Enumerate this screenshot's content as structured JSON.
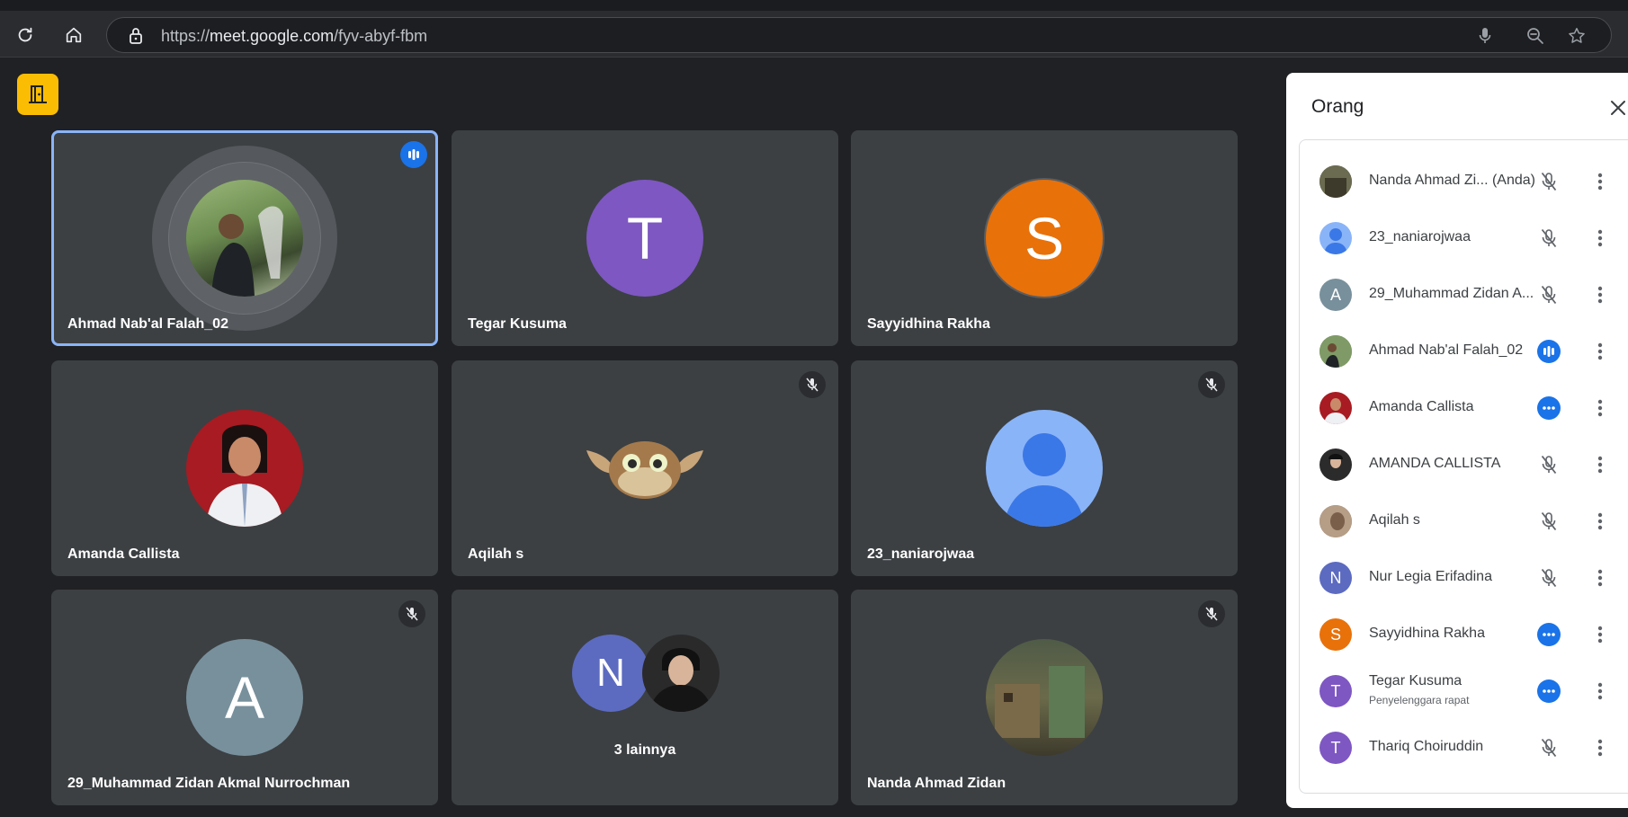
{
  "browser": {
    "url_prefix": "https://",
    "url_host": "meet.google.com",
    "url_path": "/fyv-abyf-fbm",
    "icons": [
      "reload-icon",
      "home-icon",
      "lock-icon",
      "microphone-icon",
      "zoom-icon",
      "star-icon"
    ]
  },
  "meet": {
    "accent_color": "#8ab4f8",
    "tiles": [
      {
        "name": "Ahmad Nab'al Falah_02",
        "status": "speaking"
      },
      {
        "name": "Tegar Kusuma",
        "initial": "T",
        "color": "#7e57c2"
      },
      {
        "name": "Sayyidhina Rakha",
        "initial": "S",
        "color": "#e8710a"
      },
      {
        "name": "Amanda Callista"
      },
      {
        "name": "Aqilah s",
        "status": "muted"
      },
      {
        "name": "23_naniarojwaa",
        "status": "muted"
      },
      {
        "name": "29_Muhammad Zidan Akmal Nurrochman",
        "initial": "A",
        "color": "#78909c",
        "status": "muted"
      },
      {
        "name": "",
        "initial": "N",
        "color": "#5c6bc0",
        "more_label": "3 lainnya"
      },
      {
        "name": "Nanda Ahmad Zidan",
        "status": "muted"
      }
    ]
  },
  "panel": {
    "title": "Orang",
    "people": [
      {
        "name": "Nanda Ahmad Zi...  (Anda)",
        "status": "muted"
      },
      {
        "name": "23_naniarojwaa",
        "status": "muted"
      },
      {
        "name": "29_Muhammad Zidan A...",
        "initial": "A",
        "color": "#78909c",
        "status": "muted"
      },
      {
        "name": "Ahmad Nab'al Falah_02",
        "status": "speaking"
      },
      {
        "name": "Amanda Callista",
        "status": "active"
      },
      {
        "name": "AMANDA CALLISTA",
        "status": "muted"
      },
      {
        "name": "Aqilah s",
        "status": "muted"
      },
      {
        "name": "Nur Legia Erifadina",
        "initial": "N",
        "color": "#5c6bc0",
        "status": "muted"
      },
      {
        "name": "Sayyidhina Rakha",
        "initial": "S",
        "color": "#e8710a",
        "status": "active"
      },
      {
        "name": "Tegar Kusuma",
        "subtitle": "Penyelenggara rapat",
        "initial": "T",
        "color": "#7e57c2",
        "status": "active"
      },
      {
        "name": "Thariq Choiruddin",
        "initial": "T",
        "color": "#7e57c2",
        "status": "muted"
      }
    ]
  }
}
